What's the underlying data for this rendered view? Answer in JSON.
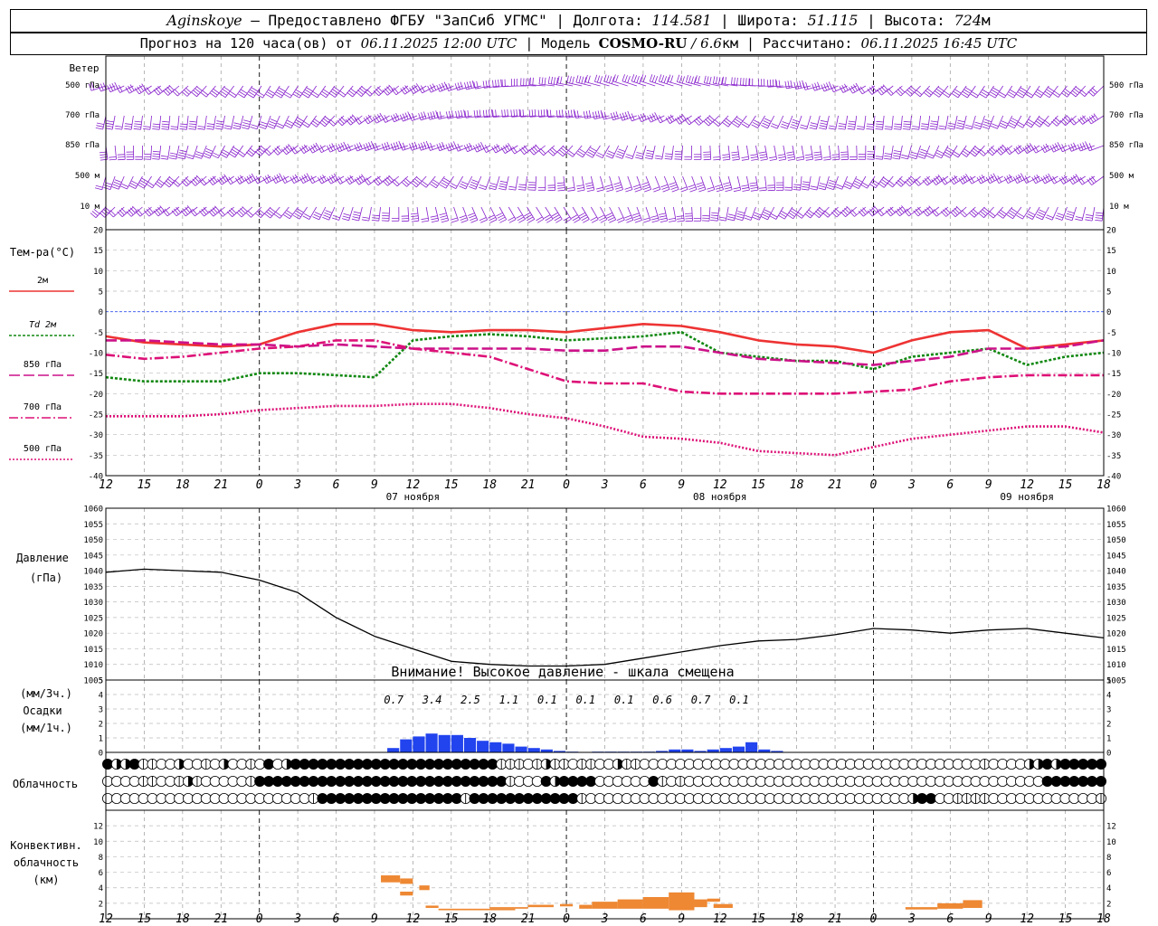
{
  "header": {
    "station": "Aginskoye",
    "provider": " – Предоставлено ФГБУ \"ЗапСиб УГМС\" | Долгота: ",
    "longitude": "114.581",
    "lat_label": " | Широта: ",
    "latitude": "51.115",
    "alt_label": " | Высота: ",
    "altitude": "724",
    "alt_unit": "м",
    "forecast_label": "Прогноз на 120 часа(ов) от ",
    "forecast_start": "06.11.2025 12:00 UTC",
    "model_label": " | Модель ",
    "model_name": "COSMO-RU",
    "model_res": " / 6.6",
    "model_unit": "км",
    "calc_label": " | Рассчитано: ",
    "calc_time": "06.11.2025 16:45 UTC"
  },
  "labels": {
    "wind_title": "Ветер",
    "wind_levels": [
      "500 гПа",
      "700 гПа",
      "850 гПа",
      "500 м",
      "10  м"
    ],
    "temp_title": "Тем-ра(°C)",
    "temp_legend": [
      {
        "label": "2м",
        "color": "#ee3333",
        "dash": ""
      },
      {
        "label": "Td  2м",
        "color": "#118811",
        "dash": "3,2"
      },
      {
        "label": "850 гПа",
        "color": "#cc1188",
        "dash": "12,4"
      },
      {
        "label": "700 гПа",
        "color": "#dd1177",
        "dash": "10,3,2,3"
      },
      {
        "label": "500 гПа",
        "color": "#dd1177",
        "dash": "2,2"
      }
    ],
    "pressure_title": "Давление",
    "pressure_unit": "(гПа)",
    "pressure_warning": "Внимание! Высокое давление - шкала смещена",
    "precip_unit3": "(мм/3ч.)",
    "precip_title": "Осадки",
    "precip_unit1": "(мм/1ч.)",
    "cloud_title": "Облачность",
    "conv_title1": "Конвективн.",
    "conv_title2": "облачность",
    "conv_unit": "(км)"
  },
  "chart_data": {
    "type": "line",
    "time_axis": {
      "hour_ticks": [
        "12",
        "15",
        "18",
        "21",
        "0",
        "3",
        "6",
        "9",
        "12",
        "15",
        "18",
        "21",
        "0",
        "3",
        "6",
        "9",
        "12",
        "15",
        "18",
        "21",
        "0",
        "3",
        "6",
        "9",
        "12",
        "15",
        "18"
      ],
      "day_labels": [
        {
          "label": "07 ноября",
          "at_tick": 8
        },
        {
          "label": "08 ноября",
          "at_tick": 16
        },
        {
          "label": "09 ноября",
          "at_tick": 24
        }
      ],
      "midnight_ticks": [
        4,
        12,
        20
      ]
    },
    "wind_panel": {
      "levels": [
        "500 гПа",
        "700 гПа",
        "850 гПа",
        "500 м",
        "10 м"
      ],
      "color": "#8822cc"
    },
    "temperature": {
      "ylim": [
        -40,
        20
      ],
      "ticks": [
        20,
        15,
        10,
        5,
        0,
        -5,
        -10,
        -15,
        -20,
        -25,
        -30,
        -35,
        -40
      ],
      "x_hours": [
        0,
        3,
        6,
        9,
        12,
        15,
        18,
        21,
        24,
        27,
        30,
        33,
        36,
        39,
        42,
        45,
        48,
        51,
        54,
        57,
        60,
        63,
        66,
        69,
        72,
        75,
        78
      ],
      "series": [
        {
          "name": "2м",
          "color": "#ee3333",
          "dash": "",
          "values": [
            -6,
            -7.5,
            -8,
            -8.5,
            -8,
            -5,
            -3,
            -3,
            -4.5,
            -5,
            -4.5,
            -4.5,
            -5,
            -4,
            -3,
            -3.5,
            -5,
            -7,
            -8,
            -8.5,
            -10,
            -7,
            -5,
            -4.5,
            -9,
            -8,
            -7
          ]
        },
        {
          "name": "Td  2м",
          "color": "#118811",
          "dash": "3,2",
          "values": [
            -16,
            -17,
            -17,
            -17,
            -15,
            -15,
            -15.5,
            -16,
            -7,
            -6,
            -5.5,
            -6,
            -7,
            -6.5,
            -6,
            -5,
            -10,
            -11,
            -12,
            -12,
            -14,
            -11,
            -10,
            -9,
            -13,
            -11,
            -10
          ]
        },
        {
          "name": "850 гПа",
          "color": "#cc1188",
          "dash": "12,4",
          "values": [
            -7,
            -7,
            -7.5,
            -8,
            -8,
            -8.5,
            -8,
            -8.5,
            -9,
            -9,
            -9,
            -9,
            -9.5,
            -9.5,
            -8.5,
            -8.5,
            -10,
            -11.5,
            -12,
            -12.5,
            -13,
            -12,
            -11,
            -9,
            -9,
            -8.5,
            -7
          ]
        },
        {
          "name": "700 гПа",
          "color": "#dd1177",
          "dash": "10,3,2,3",
          "values": [
            -10.5,
            -11.5,
            -11,
            -10,
            -9,
            -8.5,
            -7,
            -7,
            -9,
            -10,
            -11,
            -14,
            -17,
            -17.5,
            -17.5,
            -19.5,
            -20,
            -20,
            -20,
            -20,
            -19.5,
            -19,
            -17,
            -16,
            -15.5,
            -15.5,
            -15.5
          ]
        },
        {
          "name": "500 гПа",
          "color": "#dd1177",
          "dash": "2,2",
          "values": [
            -25.5,
            -25.5,
            -25.5,
            -25,
            -24,
            -23.5,
            -23,
            -23,
            -22.5,
            -22.5,
            -23.5,
            -25,
            -26,
            -28,
            -30.5,
            -31,
            -32,
            -34,
            -34.5,
            -35,
            -33,
            -31,
            -30,
            -29,
            -28,
            -28,
            -29.5
          ]
        }
      ]
    },
    "pressure": {
      "ylim": [
        1005,
        1060
      ],
      "ticks": [
        1060,
        1055,
        1050,
        1045,
        1040,
        1035,
        1030,
        1025,
        1020,
        1015,
        1010,
        1005
      ],
      "x_hours": [
        0,
        3,
        6,
        9,
        12,
        15,
        18,
        21,
        24,
        27,
        30,
        33,
        36,
        39,
        42,
        45,
        48,
        51,
        54,
        57,
        60,
        63,
        66,
        69,
        72,
        75,
        78
      ],
      "values": [
        1039.5,
        1040.5,
        1040,
        1039.5,
        1037,
        1033,
        1025,
        1019,
        1015,
        1011,
        1010,
        1009.5,
        1009.5,
        1010,
        1012,
        1014,
        1016,
        1017.5,
        1018,
        1019.5,
        1021.5,
        1021,
        1020,
        1021,
        1021.5,
        1020,
        1018.5
      ],
      "color": "#000000"
    },
    "precipitation": {
      "ylim": [
        0,
        5
      ],
      "ticks": [
        5,
        4,
        3,
        2,
        1,
        0
      ],
      "sums_3h": [
        {
          "value": "0.7",
          "at_hour": 22.5
        },
        {
          "value": "3.4",
          "at_hour": 25.5
        },
        {
          "value": "2.5",
          "at_hour": 28.5
        },
        {
          "value": "1.1",
          "at_hour": 31.5
        },
        {
          "value": "0.1",
          "at_hour": 34.5
        },
        {
          "value": "0.1",
          "at_hour": 37.5
        },
        {
          "value": "0.1",
          "at_hour": 40.5
        },
        {
          "value": "0.6",
          "at_hour": 43.5
        },
        {
          "value": "0.7",
          "at_hour": 46.5
        },
        {
          "value": "0.1",
          "at_hour": 49.5
        }
      ],
      "start_hour": 22,
      "hourly": [
        0.3,
        0.9,
        1.1,
        1.3,
        1.2,
        1.2,
        1.0,
        0.8,
        0.7,
        0.6,
        0.4,
        0.3,
        0.2,
        0.1,
        0.05,
        0,
        0.05,
        0.05,
        0.05,
        0.05,
        0.05,
        0.1,
        0.2,
        0.2,
        0.1,
        0.2,
        0.3,
        0.4,
        0.7,
        0.2,
        0.1
      ],
      "color": "#2244ee"
    },
    "cloudiness": {
      "rows": [
        "4,3,3,4,2,2,1,1,3,1,1,2,1,3,1,1,2,1,4,1,3,4,4,4,4,4,4,4,4,4,4,4,4,4,4,4,4,4,4,4,4,4,4,4,2,2,2,1,2,3,2,2,1,2,2,1,1,3,2,2,1,1,1,1,1,1,1,1,1,1,1,1,1,1,1,1,1,1,1,1,1,1,1,1,1,1,1,1,1,1,1,1,1,1,1,1,1,1,2,1,1,1,1,3,3,4,3,4,4,4,4,4",
        "1,1,1,1,2,2,1,1,2,3,2,1,1,1,1,1,2,4,4,4,4,4,4,4,4,4,4,4,4,4,4,4,4,4,4,4,4,4,4,4,4,4,4,4,4,2,1,1,1,4,3,4,4,4,4,1,1,1,1,1,1,4,2,1,2,1,1,1,1,1,1,1,1,1,1,1,1,1,1,1,1,1,1,1,1,1,1,1,1,1,1,1,1,1,1,1,1,1,1,1,1,1,1,1,1,4,4,4,4,4,4,4",
        "1,1,1,1,1,1,1,1,1,1,1,1,1,1,1,1,1,1,1,1,1,1,1,2,4,4,4,4,4,4,4,4,4,4,4,4,4,4,4,4,2,4,4,4,4,4,4,4,4,4,4,4,4,2,1,1,1,1,1,1,1,1,1,1,1,1,1,1,1,1,1,1,1,1,1,1,1,1,1,1,1,1,1,1,1,1,1,1,1,1,3,4,4,1,1,2,2,2,2,1,1,1,1,1,1,1,1,1,1,1,1,2"
      ]
    },
    "convective": {
      "ylim": [
        0,
        14
      ],
      "ticks": [
        12,
        10,
        8,
        6,
        4,
        2
      ],
      "color": "#ee8833",
      "bars": [
        {
          "h0": 21.5,
          "h1": 23.0,
          "base": 4.7,
          "top": 5.6
        },
        {
          "h0": 23.0,
          "h1": 24.0,
          "base": 4.5,
          "top": 5.2
        },
        {
          "h0": 23.0,
          "h1": 24.0,
          "base": 3.0,
          "top": 3.5
        },
        {
          "h0": 24.5,
          "h1": 25.3,
          "base": 3.7,
          "top": 4.3
        },
        {
          "h0": 25.0,
          "h1": 26.0,
          "base": 1.4,
          "top": 1.7
        },
        {
          "h0": 26.0,
          "h1": 32.0,
          "base": 1.1,
          "top": 1.3
        },
        {
          "h0": 30.0,
          "h1": 33.0,
          "base": 1.3,
          "top": 1.5
        },
        {
          "h0": 33.0,
          "h1": 35.0,
          "base": 1.5,
          "top": 1.8
        },
        {
          "h0": 35.5,
          "h1": 36.5,
          "base": 1.6,
          "top": 1.9
        },
        {
          "h0": 37.0,
          "h1": 38.0,
          "base": 1.3,
          "top": 1.8
        },
        {
          "h0": 38.0,
          "h1": 40.0,
          "base": 1.3,
          "top": 2.2
        },
        {
          "h0": 40.0,
          "h1": 42.0,
          "base": 1.3,
          "top": 2.5
        },
        {
          "h0": 42.0,
          "h1": 44.0,
          "base": 1.3,
          "top": 2.8
        },
        {
          "h0": 44.0,
          "h1": 46.0,
          "base": 1.1,
          "top": 3.4
        },
        {
          "h0": 46.0,
          "h1": 47.0,
          "base": 1.5,
          "top": 2.5
        },
        {
          "h0": 47.0,
          "h1": 48.0,
          "base": 2.2,
          "top": 2.6
        },
        {
          "h0": 47.5,
          "h1": 49.0,
          "base": 1.4,
          "top": 1.9
        },
        {
          "h0": 62.5,
          "h1": 65.0,
          "base": 1.2,
          "top": 1.5
        },
        {
          "h0": 65.0,
          "h1": 67.0,
          "base": 1.3,
          "top": 2.0
        },
        {
          "h0": 67.0,
          "h1": 68.5,
          "base": 1.4,
          "top": 2.4
        }
      ]
    }
  }
}
